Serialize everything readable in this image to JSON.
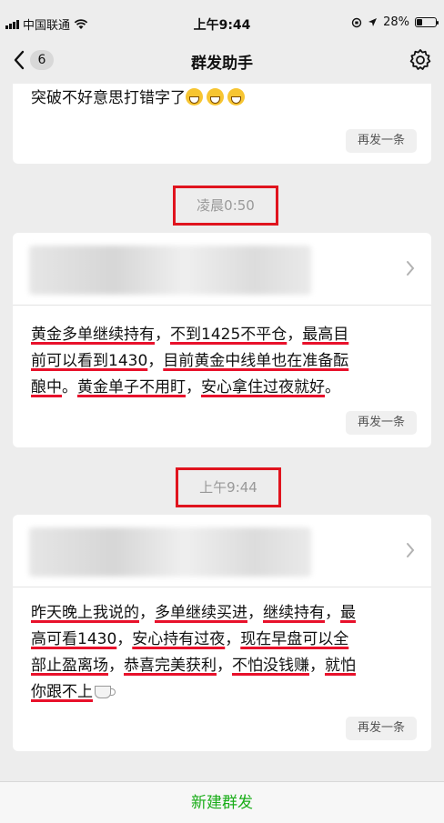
{
  "status_bar": {
    "carrier": "中国联通",
    "time": "上午9:44",
    "battery": "28%",
    "battery_level": 0.28
  },
  "nav": {
    "back_count": "6",
    "title": "群发助手"
  },
  "card1": {
    "text": "突破不好意思打错字了",
    "resend": "再发一条"
  },
  "stamp1": "凌晨0:50",
  "card2": {
    "lines": [
      {
        "segments": [
          {
            "t": "黄金多单继续持有",
            "u": true
          },
          {
            "t": "，",
            "u": false
          },
          {
            "t": "不到1425不平仓",
            "u": true
          },
          {
            "t": "，",
            "u": false
          },
          {
            "t": "最高目",
            "u": true
          }
        ]
      },
      {
        "segments": [
          {
            "t": "前可以看到1430",
            "u": true
          },
          {
            "t": "，",
            "u": false
          },
          {
            "t": "目前黄金中线单也在准备酝",
            "u": true
          }
        ]
      },
      {
        "segments": [
          {
            "t": "酿中",
            "u": true
          },
          {
            "t": "。",
            "u": false
          },
          {
            "t": "黄金单子不用盯",
            "u": true
          },
          {
            "t": "，",
            "u": false
          },
          {
            "t": "安心拿住过夜就好",
            "u": true
          },
          {
            "t": "。",
            "u": false
          }
        ]
      }
    ],
    "resend": "再发一条"
  },
  "stamp2": "上午9:44",
  "card3": {
    "lines": [
      {
        "segments": [
          {
            "t": "昨天晚上我说的",
            "u": true
          },
          {
            "t": "，",
            "u": false
          },
          {
            "t": "多单继续买进",
            "u": true
          },
          {
            "t": "，",
            "u": false
          },
          {
            "t": "继续持有",
            "u": true
          },
          {
            "t": "，",
            "u": false
          },
          {
            "t": "最",
            "u": true
          }
        ]
      },
      {
        "segments": [
          {
            "t": "高可看1430",
            "u": true
          },
          {
            "t": "，",
            "u": false
          },
          {
            "t": "安心持有过夜",
            "u": true
          },
          {
            "t": "，",
            "u": false
          },
          {
            "t": "现在早盘可以全",
            "u": true
          }
        ]
      },
      {
        "segments": [
          {
            "t": "部止盈离场",
            "u": true
          },
          {
            "t": "，",
            "u": false
          },
          {
            "t": "恭喜完美获利",
            "u": true
          },
          {
            "t": "，",
            "u": false
          },
          {
            "t": "不怕没钱赚",
            "u": true
          },
          {
            "t": "，",
            "u": false
          },
          {
            "t": "就怕",
            "u": true
          }
        ]
      },
      {
        "segments": [
          {
            "t": "你跟不上",
            "u": true
          }
        ]
      }
    ],
    "resend": "再发一条"
  },
  "bottom_button": "新建群发",
  "colors": {
    "accent_green": "#1aad19",
    "annotation_red": "#e0141e"
  },
  "icons": [
    "signal-icon",
    "wifi-icon",
    "location-icon",
    "battery-icon",
    "back-chevron-icon",
    "gear-icon",
    "grin-emoji-icon",
    "coffee-emoji-icon",
    "chevron-right-icon"
  ]
}
